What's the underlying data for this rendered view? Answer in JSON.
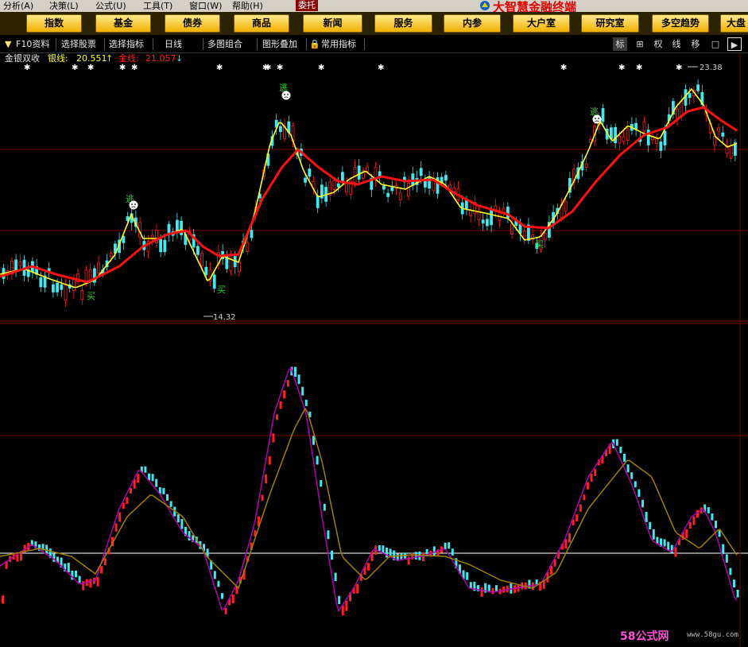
{
  "menu": {
    "items": [
      "分析(A)",
      "决策(L)",
      "公式(U)",
      "工具(T)",
      "窗口(W)",
      "帮助(H)"
    ],
    "ticker_label": "委托"
  },
  "app": {
    "title": "大智慧金融终端"
  },
  "nav": {
    "buttons": [
      "指数",
      "基金",
      "债券",
      "商品",
      "新闻",
      "服务",
      "内参",
      "大户室",
      "研究室",
      "多空趋势",
      "大盘"
    ]
  },
  "toolbar": {
    "items": [
      "F10资料",
      "选择股票",
      "选择指标",
      "日线",
      "多图组合",
      "图形叠加",
      "常用指标"
    ],
    "right_buttons": [
      "标",
      "⊞",
      "权",
      "线",
      "移",
      "□",
      "▶"
    ]
  },
  "indicator": {
    "name": "金银双收",
    "silver_label": "银线:",
    "silver_value": "20.551",
    "silver_arrow": "↑",
    "gold_label": "金线:",
    "gold_value": "21.057",
    "gold_arrow": "↓"
  },
  "colors": {
    "up": "#ff2020",
    "down": "#40e8f0",
    "silver_line": "#ffff20",
    "gold_line": "#ff1010",
    "osc_fast": "#b000b0",
    "osc_slow": "#a08000",
    "grid": "#7a0000",
    "zero_line": "#ffffff"
  },
  "annotations": {
    "high_price": "23.38",
    "low_price": "14.32",
    "buy_text": "买",
    "sell_text": "逃"
  },
  "watermark": {
    "brand": "58公式网",
    "url": "www.58gu.com"
  },
  "chart_data": {
    "type": "candlestick",
    "price_range": [
      14.32,
      23.38
    ],
    "grid": true,
    "series": [
      {
        "name": "银线",
        "color": "#ffff20"
      },
      {
        "name": "金线",
        "color": "#ff1010"
      }
    ],
    "oscillator": {
      "zero_line": true
    }
  }
}
